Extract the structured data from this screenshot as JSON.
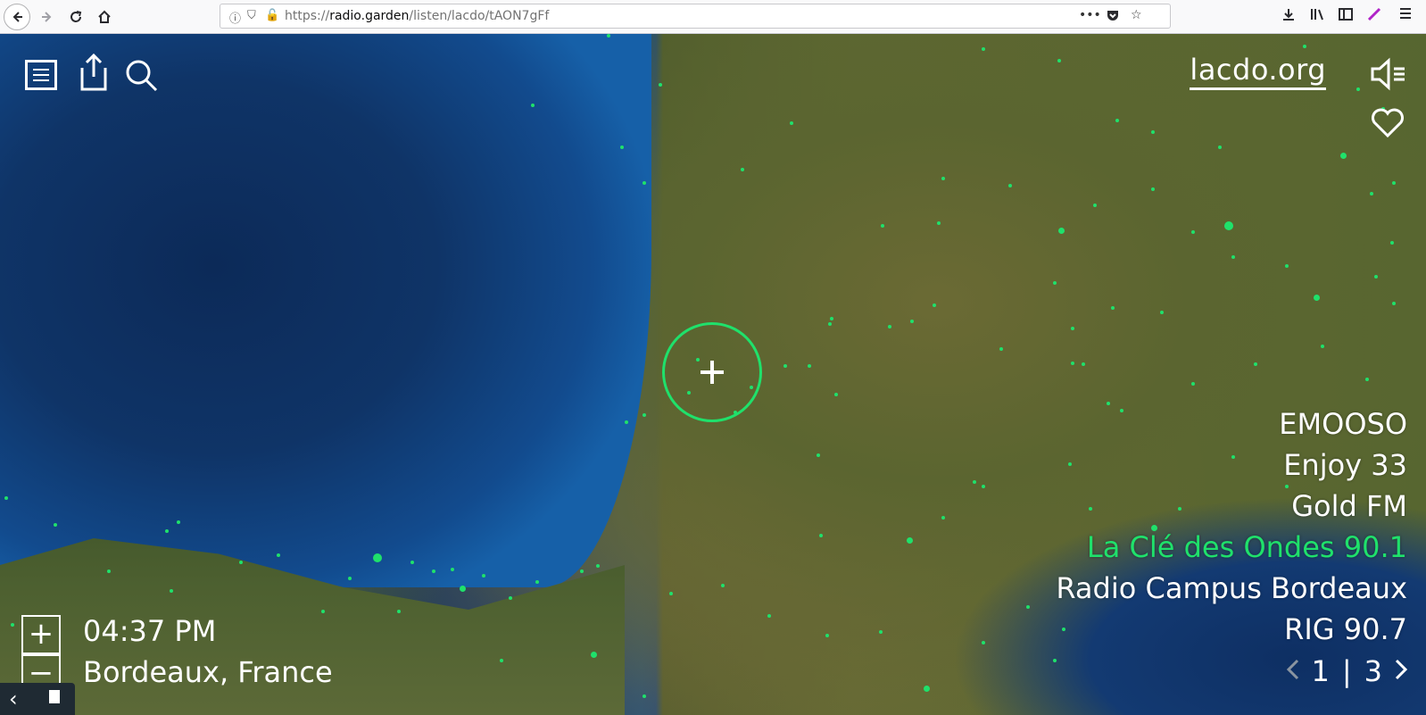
{
  "browser": {
    "url_prefix": "https://",
    "url_domain": "radio.garden",
    "url_path": "/listen/lacdo/tAON7gFf",
    "more_label": "•••"
  },
  "overlay": {
    "site_link": "lacdo.org",
    "time": "04:37 PM",
    "location": "Bordeaux, France",
    "zoom_in_label": "+",
    "zoom_out_label": "−"
  },
  "stations": [
    {
      "name": "EMOOSO",
      "active": false
    },
    {
      "name": "Enjoy 33",
      "active": false
    },
    {
      "name": "Gold FM",
      "active": false
    },
    {
      "name": "La Clé des Ondes 90.1",
      "active": true
    },
    {
      "name": "Radio Campus Bordeaux",
      "active": false
    },
    {
      "name": "RIG 90.7",
      "active": false
    }
  ],
  "pager": {
    "current": "1",
    "separator": "|",
    "total": "3",
    "prev_icon": "chevron-left-icon",
    "next_icon": "chevron-right-icon"
  },
  "colors": {
    "accent": "#1fe16b",
    "text": "#ffffff"
  }
}
